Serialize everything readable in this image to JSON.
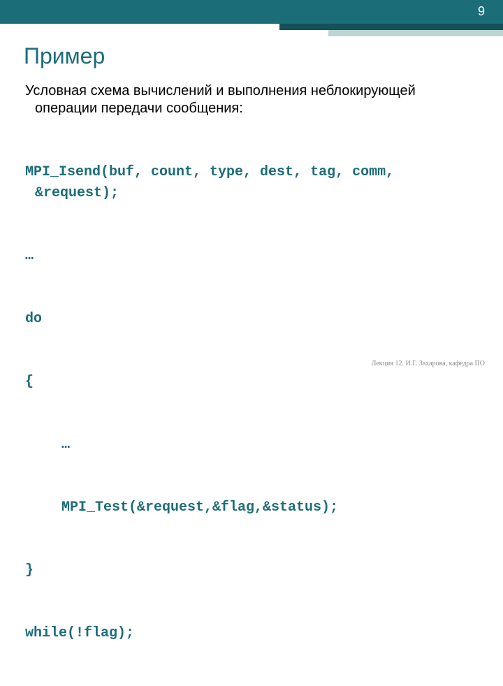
{
  "page_number": "9",
  "title": "Пример",
  "intro": "Условная схема вычислений и выполнения неблокирующей операции передачи сообщения:",
  "code": {
    "l1": "MPI_Isend(buf, count, type, dest, tag, comm, &request);",
    "l2": "…",
    "l3": "do",
    "l4": "{",
    "l5": "…",
    "l6": "MPI_Test(&request,&flag,&status);",
    "l7": "}",
    "l8": "while(!flag);"
  },
  "footer": "Лекция 12. И.Г. Захарова, кафедра ПО"
}
